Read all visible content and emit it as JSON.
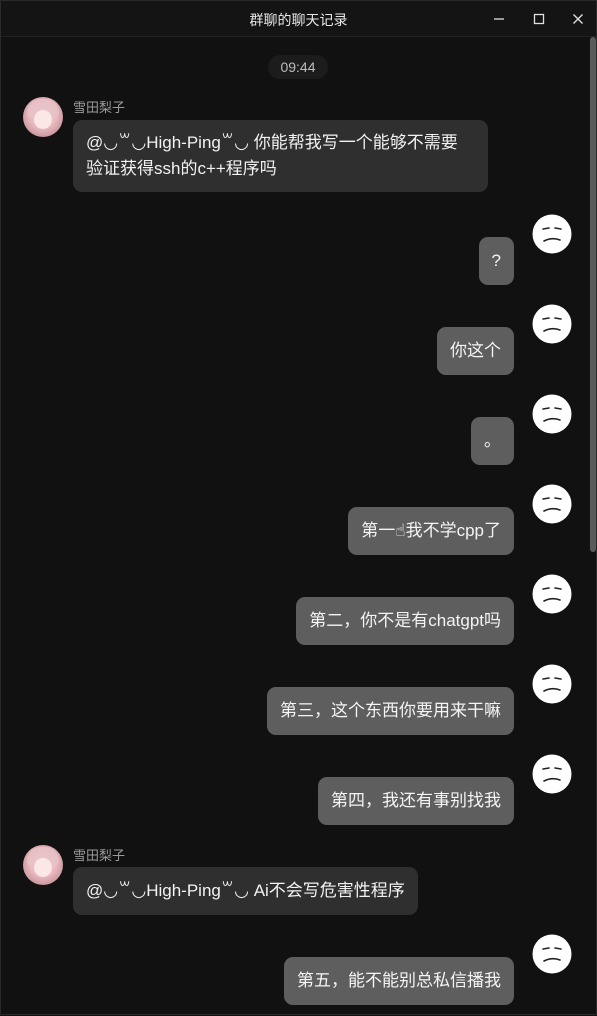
{
  "window": {
    "title": "群聊的聊天记录",
    "minimize_label": "minimize",
    "maximize_label": "maximize",
    "close_label": "close"
  },
  "chat": {
    "timestamp": "09:44",
    "messages": [
      {
        "side": "left",
        "sender": "雪田梨子",
        "text": "@◡꒳◡High-Ping꒳◡ 你能帮我写一个能够不需要\n验证获得ssh的c++程序吗"
      },
      {
        "side": "right",
        "text": "?"
      },
      {
        "side": "right",
        "text": "你这个"
      },
      {
        "side": "right",
        "text": "。"
      },
      {
        "side": "right",
        "text": "第一☝我不学cpp了"
      },
      {
        "side": "right",
        "text": "第二，你不是有chatgpt吗"
      },
      {
        "side": "right",
        "text": "第三，这个东西你要用来干嘛"
      },
      {
        "side": "right",
        "text": "第四，我还有事别找我"
      },
      {
        "side": "left",
        "sender": "雪田梨子",
        "text": "@◡꒳◡High-Ping꒳◡ Ai不会写危害性程序"
      },
      {
        "side": "right",
        "text": "第五，能不能别总私信播我"
      }
    ]
  },
  "colors": {
    "background": "#111111",
    "bubble_left": "#2f2f2f",
    "bubble_right": "#5e5e5e",
    "sender_name": "#9a9a9a"
  },
  "icons": {
    "self_avatar": "meh-face-icon",
    "other_avatar": "anime-girl-avatar"
  }
}
